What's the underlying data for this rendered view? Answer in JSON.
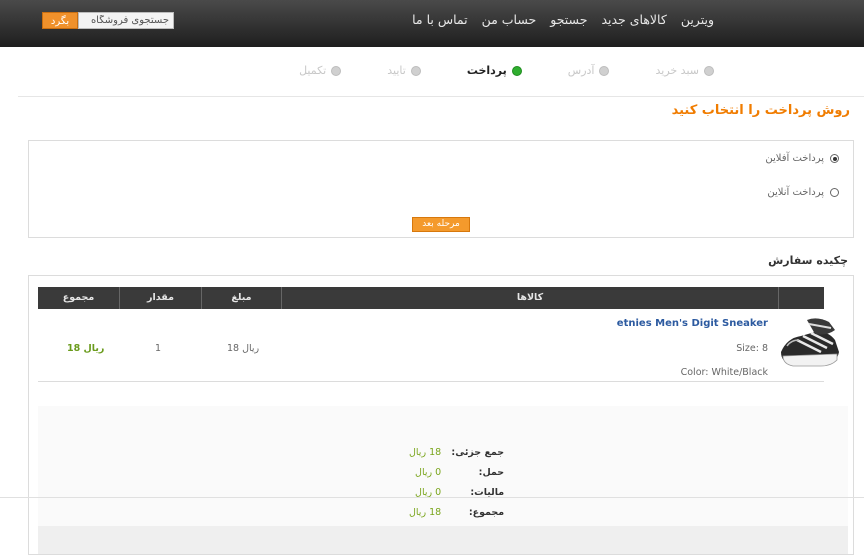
{
  "nav": {
    "items": [
      "ویترین",
      "کالاهای جدید",
      "جستجو",
      "حساب من",
      "تماس با ما"
    ],
    "search_placeholder": "جستجوی فروشگاه",
    "search_button": "بگرد"
  },
  "steps": [
    {
      "label": "سبد خرید",
      "active": false
    },
    {
      "label": "آدرس",
      "active": false
    },
    {
      "label": "پرداخت",
      "active": true
    },
    {
      "label": "تایید",
      "active": false
    },
    {
      "label": "تکمیل",
      "active": false
    }
  ],
  "page_title": "روش پرداخت را انتخاب کنید",
  "payment": {
    "option_offline": "پرداخت آفلاین",
    "option_online": "پرداخت آنلاین",
    "selected": "offline",
    "next_button": "مرحله بعد"
  },
  "summary": {
    "title": "چکیده سفارش",
    "headers": {
      "products": "کالاها",
      "price": "مبلغ",
      "qty": "مقدار",
      "total": "مجموع"
    },
    "item": {
      "name": "etnies Men's Digit Sneaker",
      "size": "Size: 8",
      "color": "Color: White/Black",
      "price": "18 ریال",
      "qty": "1",
      "total": "18 ریال"
    },
    "totals": [
      {
        "label": "جمع جزئی:",
        "value": "18 ریال"
      },
      {
        "label": "حمل:",
        "value": "0 ریال"
      },
      {
        "label": "مالیات:",
        "value": "0 ریال"
      },
      {
        "label": "مجموع:",
        "value": "18 ریال"
      }
    ]
  },
  "colors": {
    "accent": "#f07c00",
    "link": "#2c5aa0",
    "price_green": "#6a9b1c",
    "active_step": "#2fae2f"
  }
}
